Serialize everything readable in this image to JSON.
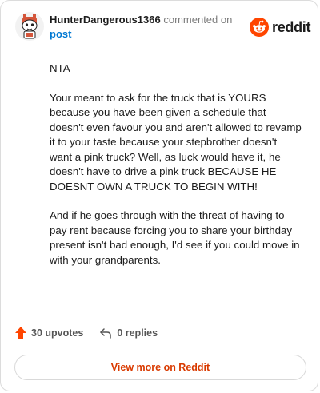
{
  "header": {
    "username": "HunterDangerous1366",
    "action_text": "commented on",
    "post_link": "post",
    "brand": "reddit"
  },
  "comment": {
    "paragraphs": [
      "NTA",
      "Your meant to ask for the truck that is YOURS because you have been given a schedule that doesn't even favour you and aren't allowed to revamp it to your taste because your stepbrother doesn't want a pink truck? Well, as luck would have it, he doesn't have to drive a pink truck BECAUSE HE DOESNT OWN A TRUCK TO BEGIN WITH!",
      "And if he goes through with the threat of having to pay rent because forcing you to share your birthday present isn't bad enough, I'd see if you could move in with your grandparents."
    ]
  },
  "footer": {
    "upvotes_label": "30 upvotes",
    "replies_label": "0 replies",
    "view_more_label": "View more on Reddit"
  },
  "colors": {
    "brand_orange": "#ff4500",
    "link_blue": "#0079d3",
    "cta_text": "#d93a00"
  }
}
